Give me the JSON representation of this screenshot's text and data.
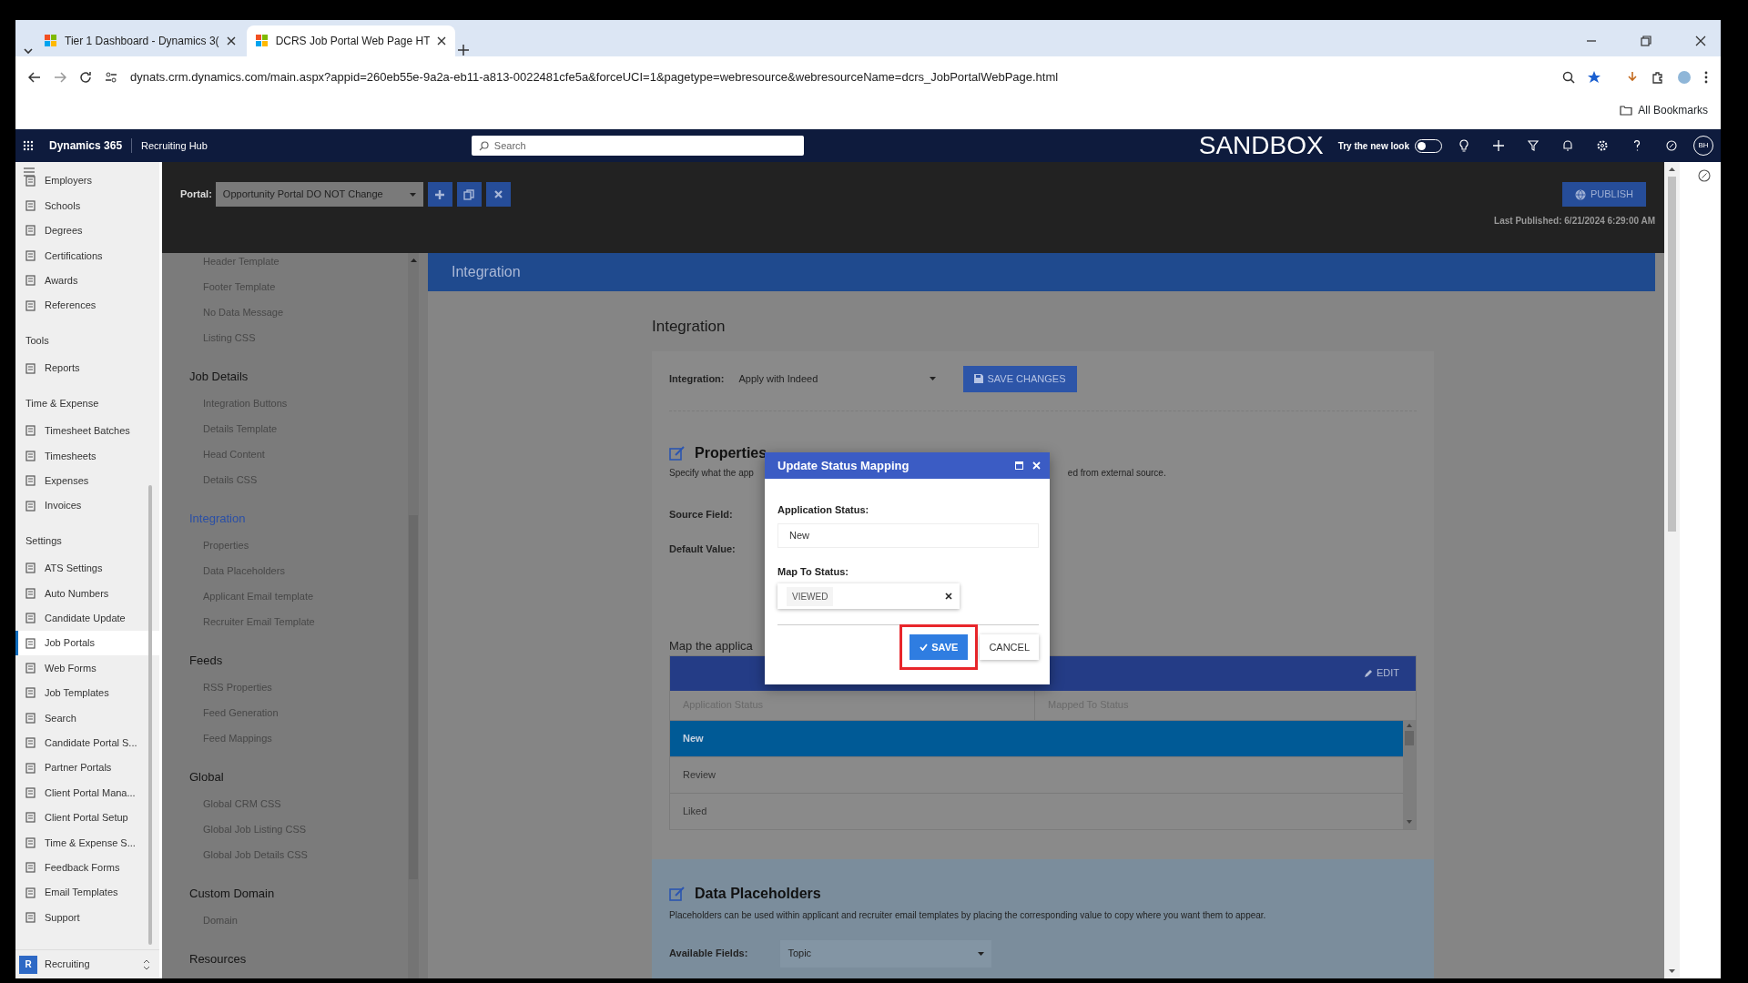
{
  "browser": {
    "tabs": [
      {
        "title": "Tier 1 Dashboard - Dynamics 3(",
        "selected": false
      },
      {
        "title": "DCRS Job Portal Web Page HT",
        "selected": true
      }
    ],
    "url": "dynats.crm.dynamics.com/main.aspx?appid=260eb55e-9a2a-eb11-a813-0022481cfe5a&forceUCI=1&pagetype=webresource&webresourceName=dcrs_JobPortalWebPage.html",
    "bookmarks_label": "All Bookmarks"
  },
  "app_bar": {
    "brand": "Dynamics 365",
    "app": "Recruiting Hub",
    "search_placeholder": "Search",
    "environment": "SANDBOX",
    "new_look_label": "Try the new look",
    "new_look_on": false,
    "avatar": "BH"
  },
  "sidebar": {
    "groups": [
      {
        "items": [
          {
            "label": "Employers",
            "selected": false
          },
          {
            "label": "Schools",
            "selected": false
          },
          {
            "label": "Degrees",
            "selected": false
          },
          {
            "label": "Certifications",
            "selected": false
          },
          {
            "label": "Awards",
            "selected": false
          },
          {
            "label": "References",
            "selected": false
          }
        ]
      },
      {
        "title": "Tools",
        "items": [
          {
            "label": "Reports",
            "selected": false
          }
        ]
      },
      {
        "title": "Time & Expense",
        "items": [
          {
            "label": "Timesheet Batches",
            "selected": false
          },
          {
            "label": "Timesheets",
            "selected": false
          },
          {
            "label": "Expenses",
            "selected": false
          },
          {
            "label": "Invoices",
            "selected": false
          }
        ]
      },
      {
        "title": "Settings",
        "items": [
          {
            "label": "ATS Settings",
            "selected": false
          },
          {
            "label": "Auto Numbers",
            "selected": false
          },
          {
            "label": "Candidate Update",
            "selected": false
          },
          {
            "label": "Job Portals",
            "selected": true
          },
          {
            "label": "Web Forms",
            "selected": false
          },
          {
            "label": "Job Templates",
            "selected": false
          },
          {
            "label": "Search",
            "selected": false
          },
          {
            "label": "Candidate Portal S...",
            "selected": false
          },
          {
            "label": "Partner Portals",
            "selected": false
          },
          {
            "label": "Client Portal Mana...",
            "selected": false
          },
          {
            "label": "Client Portal Setup",
            "selected": false
          },
          {
            "label": "Time & Expense S...",
            "selected": false
          },
          {
            "label": "Feedback Forms",
            "selected": false
          },
          {
            "label": "Email Templates",
            "selected": false
          },
          {
            "label": "Support",
            "selected": false
          }
        ]
      }
    ],
    "area": {
      "initial": "R",
      "label": "Recruiting"
    }
  },
  "portal_bar": {
    "label": "Portal:",
    "value": "Opportunity Portal DO NOT Change",
    "publish": "PUBLISH",
    "last_published": "Last Published: 6/21/2024 6:29:00 AM"
  },
  "nav": {
    "groups": [
      {
        "items": [
          "Header Template",
          "Footer Template",
          "No Data Message",
          "Listing CSS"
        ]
      },
      {
        "title": "Job Details",
        "selected": false,
        "items": [
          "Integration Buttons",
          "Details Template",
          "Head Content",
          "Details CSS"
        ]
      },
      {
        "title": "Integration",
        "selected": true,
        "items": [
          "Properties",
          "Data Placeholders",
          "Applicant Email template",
          "Recruiter Email Template"
        ]
      },
      {
        "title": "Feeds",
        "selected": false,
        "items": [
          "RSS Properties",
          "Feed Generation",
          "Feed Mappings"
        ]
      },
      {
        "title": "Global",
        "selected": false,
        "items": [
          "Global CRM CSS",
          "Global Job Listing CSS",
          "Global Job Details CSS"
        ]
      },
      {
        "title": "Custom Domain",
        "selected": false,
        "items": [
          "Domain"
        ]
      },
      {
        "title": "Resources",
        "selected": false
      }
    ]
  },
  "content": {
    "banner": "Integration",
    "title": "Integration",
    "integration_label": "Integration:",
    "integration_value": "Apply with Indeed",
    "save_changes": "SAVE CHANGES",
    "properties": {
      "title": "Properties",
      "description_parts": [
        "Specify what the app",
        "ed from external source."
      ],
      "fields": [
        "Source Field:",
        "Default Value:"
      ],
      "map_text": "Map the applica"
    },
    "mapping_table": {
      "action": "EDIT",
      "columns": [
        "Application Status",
        "Mapped To Status"
      ],
      "rows": [
        {
          "application_status": "New",
          "selected": true
        },
        {
          "application_status": "Review",
          "selected": false
        },
        {
          "application_status": "Liked",
          "selected": false
        }
      ]
    },
    "placeholders": {
      "title": "Data Placeholders",
      "description": "Placeholders can be used within applicant and recruiter email templates by placing the corresponding value to copy where you want them to appear.",
      "field_label": "Available Fields:",
      "field_value": "Topic"
    }
  },
  "dialog": {
    "title": "Update Status Mapping",
    "application_status_label": "Application Status:",
    "application_status": "New",
    "map_to_label": "Map To Status:",
    "map_to_value": "VIEWED",
    "save": "SAVE",
    "cancel": "CANCEL",
    "save_highlighted": true
  }
}
